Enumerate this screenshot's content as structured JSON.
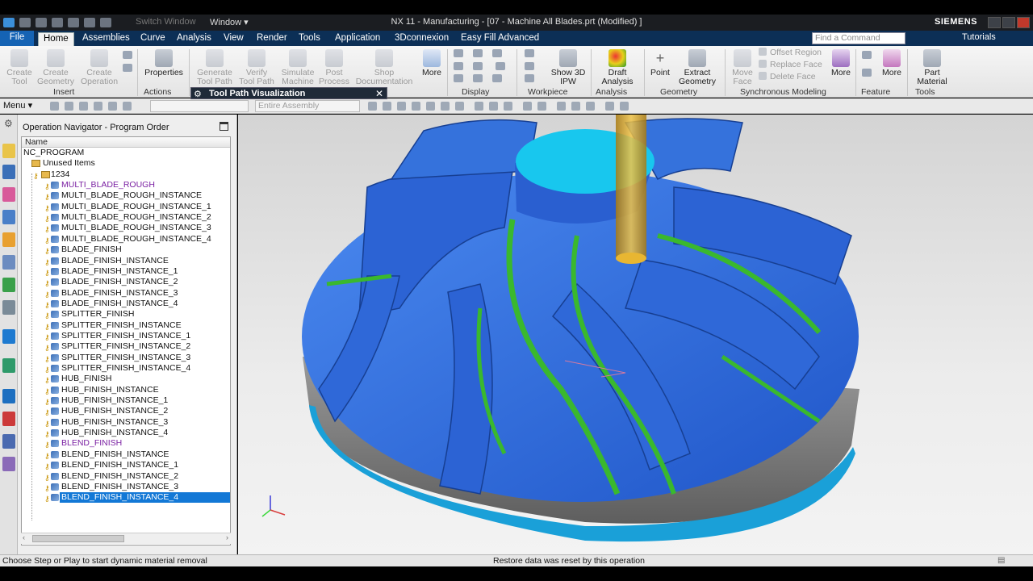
{
  "title_bar": {
    "switch_window": "Switch Window",
    "window_menu": "Window ▾",
    "window_title": "NX 11 - Manufacturing - [07 - Machine All Blades.prt (Modified) ]",
    "brand": "SIEMENS"
  },
  "menu_tabs": [
    "File",
    "Home",
    "Assemblies",
    "Curve",
    "Analysis",
    "View",
    "Render",
    "Tools",
    "Application",
    "3Dconnexion",
    "Easy Fill Advanced"
  ],
  "active_tab": "Home",
  "search": {
    "placeholder": "Find a Command"
  },
  "tutorials": "Tutorials",
  "ribbon": {
    "create_tool": "Create Tool",
    "create_geometry": "Create Geometry",
    "create_operation": "Create Operation",
    "insert_group": "Insert",
    "properties": "Properties",
    "actions_group": "Actions",
    "generate_tool_path": "Generate Tool Path",
    "verify_tool_path": "Verify Tool Path",
    "simulate_machine": "Simulate Machine",
    "post_process": "Post Process",
    "shop_documentation": "Shop Documentation",
    "more1": "More",
    "display_group": "Display",
    "show_3d_ipw": "Show 3D IPW",
    "workpiece_group": "Workpiece",
    "draft_analysis": "Draft Analysis",
    "analysis_group": "Analysis",
    "point": "Point",
    "extract_geometry": "Extract Geometry",
    "geometry_group": "Geometry",
    "move_face": "Move Face",
    "offset_region": "Offset Region",
    "replace_face": "Replace Face",
    "delete_face": "Delete Face",
    "more2": "More",
    "sync_group": "Synchronous Modeling",
    "more3": "More",
    "feature_group": "Feature",
    "part_material": "Part Material",
    "tools_group": "Tools"
  },
  "toolbar": {
    "menu": "Menu ▾",
    "filter_value": "",
    "assembly_scope": "Entire Assembly"
  },
  "tool_path_visualization": {
    "title": "Tool Path Visualization"
  },
  "navigator": {
    "title": "Operation Navigator - Program Order",
    "column": "Name",
    "root": "NC_PROGRAM",
    "unused": "Unused Items",
    "program": "1234",
    "operations": [
      {
        "name": "MULTI_BLADE_ROUGH",
        "style": "purple"
      },
      {
        "name": "MULTI_BLADE_ROUGH_INSTANCE",
        "style": "normal"
      },
      {
        "name": "MULTI_BLADE_ROUGH_INSTANCE_1",
        "style": "normal"
      },
      {
        "name": "MULTI_BLADE_ROUGH_INSTANCE_2",
        "style": "normal"
      },
      {
        "name": "MULTI_BLADE_ROUGH_INSTANCE_3",
        "style": "normal"
      },
      {
        "name": "MULTI_BLADE_ROUGH_INSTANCE_4",
        "style": "normal"
      },
      {
        "name": "BLADE_FINISH",
        "style": "normal"
      },
      {
        "name": "BLADE_FINISH_INSTANCE",
        "style": "normal"
      },
      {
        "name": "BLADE_FINISH_INSTANCE_1",
        "style": "normal"
      },
      {
        "name": "BLADE_FINISH_INSTANCE_2",
        "style": "normal"
      },
      {
        "name": "BLADE_FINISH_INSTANCE_3",
        "style": "normal"
      },
      {
        "name": "BLADE_FINISH_INSTANCE_4",
        "style": "normal"
      },
      {
        "name": "SPLITTER_FINISH",
        "style": "normal"
      },
      {
        "name": "SPLITTER_FINISH_INSTANCE",
        "style": "normal"
      },
      {
        "name": "SPLITTER_FINISH_INSTANCE_1",
        "style": "normal"
      },
      {
        "name": "SPLITTER_FINISH_INSTANCE_2",
        "style": "normal"
      },
      {
        "name": "SPLITTER_FINISH_INSTANCE_3",
        "style": "normal"
      },
      {
        "name": "SPLITTER_FINISH_INSTANCE_4",
        "style": "normal"
      },
      {
        "name": "HUB_FINISH",
        "style": "normal"
      },
      {
        "name": "HUB_FINISH_INSTANCE",
        "style": "normal"
      },
      {
        "name": "HUB_FINISH_INSTANCE_1",
        "style": "normal"
      },
      {
        "name": "HUB_FINISH_INSTANCE_2",
        "style": "normal"
      },
      {
        "name": "HUB_FINISH_INSTANCE_3",
        "style": "normal"
      },
      {
        "name": "HUB_FINISH_INSTANCE_4",
        "style": "normal"
      },
      {
        "name": "BLEND_FINISH",
        "style": "purple"
      },
      {
        "name": "BLEND_FINISH_INSTANCE",
        "style": "normal"
      },
      {
        "name": "BLEND_FINISH_INSTANCE_1",
        "style": "normal"
      },
      {
        "name": "BLEND_FINISH_INSTANCE_2",
        "style": "normal"
      },
      {
        "name": "BLEND_FINISH_INSTANCE_3",
        "style": "normal"
      },
      {
        "name": "BLEND_FINISH_INSTANCE_4",
        "style": "selected"
      }
    ]
  },
  "status": {
    "left": "Choose Step or Play to start dynamic material removal",
    "center": "Restore data was reset by this operation"
  },
  "colors": {
    "accent": "#1563b4",
    "part_blue": "#2f6fe0",
    "fillet_green": "#3ab82e",
    "stock_cyan": "#17c3e8",
    "tool_yellow": "#d9a520",
    "selected_row": "#1378d6"
  }
}
